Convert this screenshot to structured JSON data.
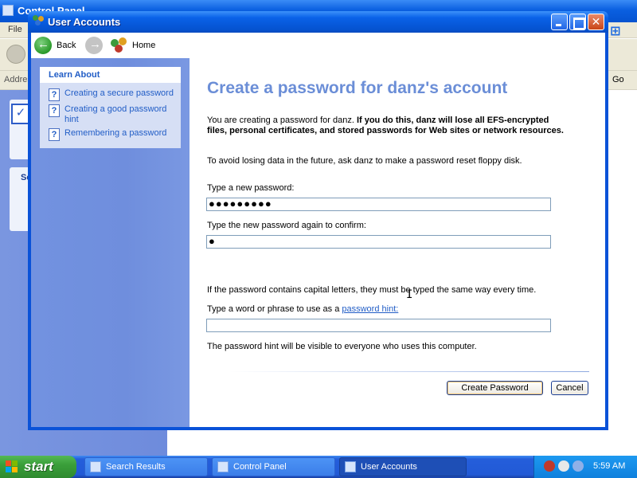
{
  "background_window": {
    "title": "Control Panel",
    "menu_first": "File",
    "address_label": "Address",
    "go_label": "Go",
    "section_label": "Se"
  },
  "window": {
    "title": "User Accounts",
    "controls": {
      "minimize": "",
      "maximize": "",
      "close": "✕"
    }
  },
  "nav": {
    "back": "Back",
    "home": "Home"
  },
  "learn_about": {
    "heading": "Learn About",
    "items": [
      {
        "label": "Creating a secure password"
      },
      {
        "label": "Creating a good password hint"
      },
      {
        "label": "Remembering a password"
      }
    ]
  },
  "content": {
    "title": "Create a password for danz's account",
    "intro_plain": "You are creating a password for danz. ",
    "intro_bold": "If you do this, danz will lose all EFS-encrypted files, personal certificates, and stored passwords for Web sites or network resources.",
    "reset_note": "To avoid losing data in the future, ask danz to make a password reset floppy disk.",
    "new_password_label": "Type a new password:",
    "new_password_value": "●●●●●●●●●",
    "confirm_label": "Type the new password again to confirm:",
    "confirm_value": "●",
    "case_note": "If the password contains capital letters, they must be typed the same way every time.",
    "hint_label_prefix": "Type a word or phrase to use as a ",
    "hint_link": "password hint:",
    "hint_value": "",
    "hint_visibility_note": "The password hint will be visible to everyone who uses this computer.",
    "create_button": "Create Password",
    "cancel_button": "Cancel"
  },
  "taskbar": {
    "start_label": "start",
    "tasks": [
      {
        "label": "Search Results"
      },
      {
        "label": "Control Panel"
      },
      {
        "label": "User Accounts"
      }
    ],
    "clock": "5:59 AM"
  },
  "colors": {
    "title_accent": "#6b8ed7",
    "link": "#215dc6",
    "left_pane": "#7292e0",
    "titlebar": "#0553d0",
    "start_green": "#3a9f3a"
  }
}
